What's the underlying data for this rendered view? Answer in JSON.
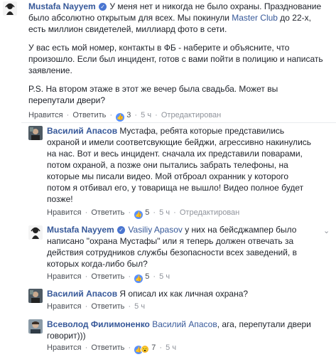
{
  "comments": [
    {
      "author": "Mustafa Nayyem",
      "verified": true,
      "paragraphs": [
        [
          "У меня нет и никогда не было охраны. Празднование",
          "было абсолютно открытым для всех. Мы покинули ",
          "Master Club",
          " до 22-х,",
          "есть миллион свидетелей, миллиард фото в сети."
        ],
        [
          "У вас есть мой номер, контакты в ФБ - наберите и объясните, что",
          "произошло. Если был инцидент, готов с вами пойти в полицию и написать",
          "заявление."
        ],
        [
          "P.S. На втором этаже в этот же вечер была свадьба. Может вы",
          "перепутали двери?"
        ]
      ],
      "like_label": "Нравится",
      "reply_label": "Ответить",
      "reactions": "3",
      "time": "5 ч",
      "edited": "Отредактирован"
    },
    {
      "author": "Василий Апасов",
      "lines": [
        "Мустафа, ребята которые представились",
        "охраной и имели соответсвующие бейджи, агрессивно накинулись",
        "на нас. Вот и весь инцидент. сначала их представили поварами,",
        "потом охраной, а позже они пытались забрать телефоны, на",
        "которые мы писали видео. Мой отброал охранник у которого",
        "потом я отбивал его, у товарища не вышло! Видео полное будет",
        "позже!"
      ],
      "like_label": "Нравится",
      "reply_label": "Ответить",
      "reactions": "5",
      "time": "5 ч",
      "edited": "Отредактирован"
    },
    {
      "author": "Mustafa Nayyem",
      "verified": true,
      "mention": "Vasiliy Apasov",
      "lines_first": " у них на бейсджампер было",
      "lines": [
        "написано \"охрана Мустафы\" или я теперь должен отвечать за",
        "действия сотрудников службы безопасности всех заведений, в",
        "которых когда-либо был?"
      ],
      "like_label": "Нравится",
      "reply_label": "Ответить",
      "reactions": "5",
      "time": "5 ч"
    },
    {
      "author": "Василий Апасов",
      "text": "Я описал их как личная охрана?",
      "like_label": "Нравится",
      "reply_label": "Ответить",
      "time": "5 ч"
    },
    {
      "author": "Всеволод Филимоненко",
      "mention": "Василий Апасов",
      "text_first": ", ага, перепутали двери",
      "text_second": "говорит)))",
      "like_label": "Нравится",
      "reply_label": "Ответить",
      "reactions": "7",
      "time": "5 ч"
    }
  ],
  "colors": {
    "link": "#365899",
    "meta": "#90949c",
    "like": "#5890ff"
  },
  "icons": {
    "verified": "check-badge-icon",
    "like": "thumbs-up-icon",
    "wow": "wow-emoji-icon",
    "more": "chevron-down-icon"
  },
  "glyphs": {
    "separator": "·",
    "check": "✓",
    "like": "👍",
    "wow": "😮",
    "chevron": "⌄"
  }
}
